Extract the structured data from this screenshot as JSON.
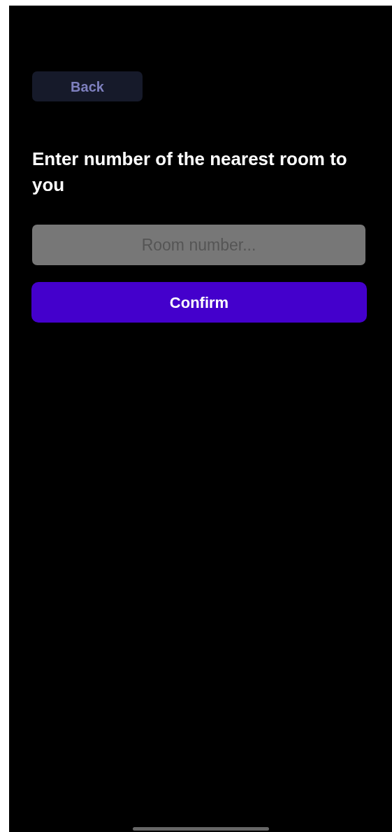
{
  "back_button": {
    "label": "Back"
  },
  "heading": "Enter number of the nearest room to you",
  "room_field": {
    "placeholder": "Room number..."
  },
  "confirm_button": {
    "label": "Confirm"
  }
}
